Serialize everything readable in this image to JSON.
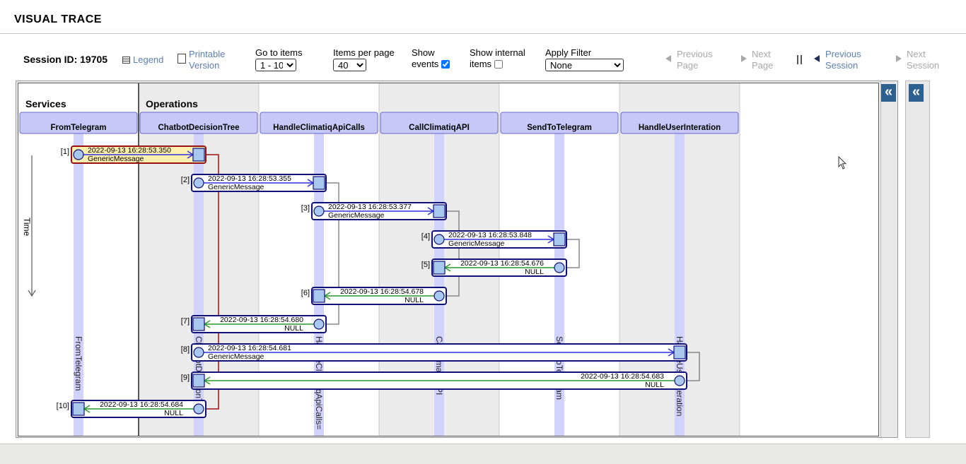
{
  "page_title": "VISUAL TRACE",
  "toolbar": {
    "session_label": "Session ID: 19705",
    "legend_label": "Legend",
    "printable_line1": "Printable",
    "printable_line2": "Version",
    "goto_label": "Go to items",
    "goto_value": "1 - 10",
    "per_page_label": "Items per page",
    "per_page_value": "40",
    "show_events_line1": "Show",
    "show_events_line2": "events",
    "show_events_checked": true,
    "show_internal_line1": "Show internal",
    "show_internal_line2": "items",
    "show_internal_checked": false,
    "filter_label": "Apply Filter",
    "filter_value": "None",
    "prev_page_line1": "Previous",
    "prev_page_line2": "Page",
    "next_page_line1": "Next",
    "next_page_line2": "Page",
    "prev_session_line1": "Previous",
    "prev_session_line2": "Session",
    "next_session_line1": "Next",
    "next_session_line2": "Session"
  },
  "diagram": {
    "services_label": "Services",
    "operations_label": "Operations",
    "time_label": "Time",
    "lanes": [
      {
        "name": "FromTelegram",
        "vertical_label": "FromTelegram"
      },
      {
        "name": "ChatbotDecisionTree",
        "vertical_label": "ChatbotDecisionTree"
      },
      {
        "name": "HandleClimatiqApiCalls",
        "vertical_label": "HandleClimatiqApiCalls="
      },
      {
        "name": "CallClimatiqAPI",
        "vertical_label": "CallClimatiqAPI"
      },
      {
        "name": "SendToTelegram",
        "vertical_label": "SendToTelegram"
      },
      {
        "name": "HandleUserInteration",
        "vertical_label": "HandleUserInteration"
      }
    ],
    "messages": [
      {
        "index": "[1]",
        "from": 0,
        "to": 1,
        "time": "2022-09-13 16:28:53.350",
        "label": "GenericMessage",
        "kind": "request",
        "highlight": true
      },
      {
        "index": "[2]",
        "from": 1,
        "to": 2,
        "time": "2022-09-13 16:28:53.355",
        "label": "GenericMessage",
        "kind": "request"
      },
      {
        "index": "[3]",
        "from": 2,
        "to": 3,
        "time": "2022-09-13 16:28:53.377",
        "label": "GenericMessage",
        "kind": "request"
      },
      {
        "index": "[4]",
        "from": 3,
        "to": 4,
        "time": "2022-09-13 16:28:53.848",
        "label": "GenericMessage",
        "kind": "request"
      },
      {
        "index": "[5]",
        "from": 4,
        "to": 3,
        "time": "2022-09-13 16:28:54.676",
        "label": "NULL",
        "kind": "response"
      },
      {
        "index": "[6]",
        "from": 3,
        "to": 2,
        "time": "2022-09-13 16:28:54.678",
        "label": "NULL",
        "kind": "response"
      },
      {
        "index": "[7]",
        "from": 2,
        "to": 1,
        "time": "2022-09-13 16:28:54.680",
        "label": "NULL",
        "kind": "response"
      },
      {
        "index": "[8]",
        "from": 1,
        "to": 5,
        "time": "2022-09-13 16:28:54.681",
        "label": "GenericMessage",
        "kind": "request"
      },
      {
        "index": "[9]",
        "from": 5,
        "to": 1,
        "time": "2022-09-13 16:28:54.683",
        "label": "NULL",
        "kind": "response"
      },
      {
        "index": "[10]",
        "from": 1,
        "to": 0,
        "time": "2022-09-13 16:28:54.684",
        "label": "NULL",
        "kind": "response"
      }
    ],
    "links": [
      [
        0,
        9,
        "red"
      ],
      [
        1,
        6,
        "gray"
      ],
      [
        2,
        5,
        "gray"
      ],
      [
        3,
        4,
        "gray"
      ],
      [
        7,
        8,
        "gray"
      ]
    ]
  },
  "collapse_label": "«",
  "colors": {
    "header_bg": "#c8c8f8",
    "lane_bar": "#d2d2ff",
    "box_border": "#10107a",
    "request_arrow": "#3030e0",
    "response_arrow": "#2a9a2a",
    "highlight_bg": "#fff0b0",
    "highlight_border": "#9a1010",
    "accent": "#2d5f8f"
  }
}
